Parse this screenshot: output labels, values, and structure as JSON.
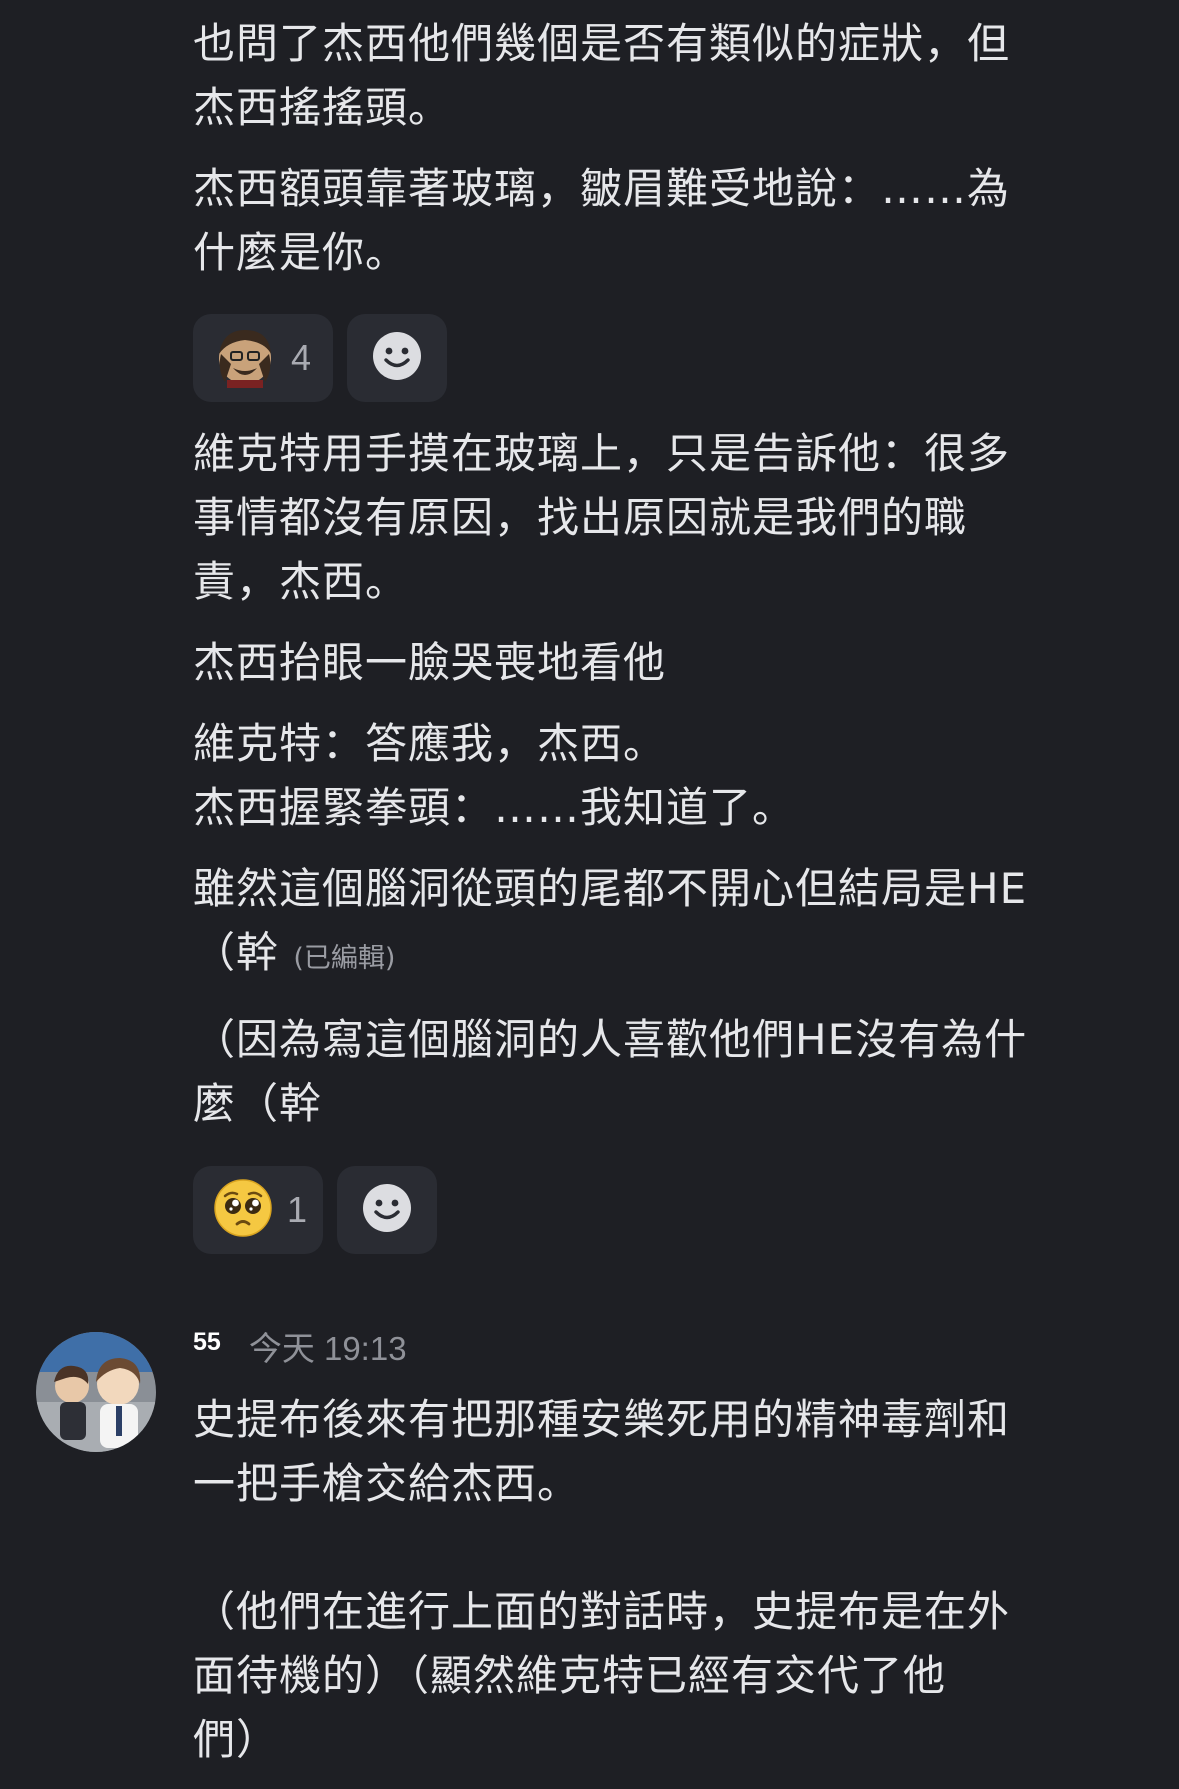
{
  "messages": [
    {
      "paragraphs": [
        "也問了杰西他們幾個是否有類似的症狀，但\n杰西搖搖頭。",
        "杰西額頭靠著玻璃，皺眉難受地說：……為\n什麼是你。"
      ],
      "reactions": [
        {
          "emoji": "custom-character-emoji-icon",
          "count": "4"
        }
      ]
    },
    {
      "paragraphs": [
        "維克特用手摸在玻璃上，只是告訴他：很多\n事情都沒有原因，找出原因就是我們的職\n責，杰西。",
        "杰西抬眼一臉哭喪地看他",
        "維克特：答應我，杰西。\n杰西握緊拳頭：……我知道了。",
        "雖然這個腦洞從頭的尾都不開心但結局是HE\n（幹"
      ],
      "edited_label": "(已編輯)",
      "last_paragraph": "（因為寫這個腦洞的人喜歡他們HE沒有為什\n麼（幹",
      "reactions": [
        {
          "emoji": "pleading-face-emoji-icon",
          "count": "1"
        }
      ]
    },
    {
      "author": "55",
      "timestamp": "今天 19:13",
      "paragraphs": [
        "史提布後來有把那種安樂死用的精神毒劑和\n一把手槍交給杰西。",
        "（他們在進行上面的對話時，史提布是在外\n面待機的）（顯然維克特已經有交代了他\n們）"
      ]
    }
  ],
  "colors": {
    "background": "#1e1f24",
    "text": "#e6e7ea",
    "reaction_bg": "#2a2c33",
    "muted": "#8f9198"
  }
}
